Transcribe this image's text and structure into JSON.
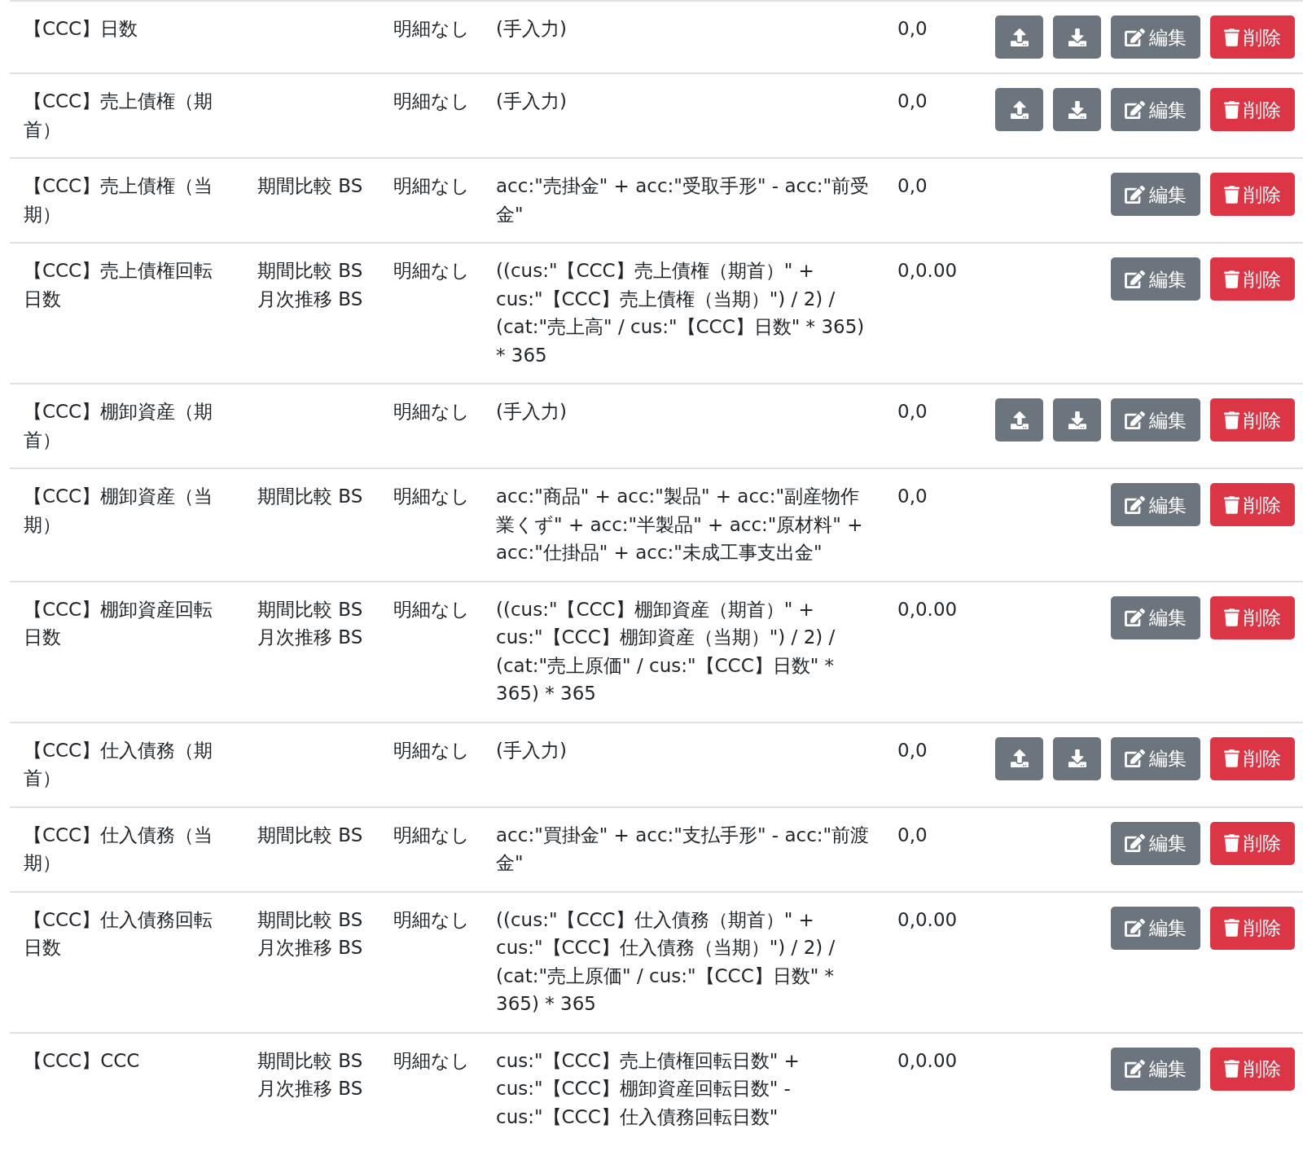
{
  "rows": [
    {
      "column_1": "【CCC】日数",
      "column_3": "明細なし",
      "column_4": "(手入力)",
      "column_5": "0,0",
      "buttons": [
        {
          "kind": "upload"
        },
        {
          "kind": "download"
        },
        {
          "kind": "edit",
          "label": "編集"
        },
        {
          "kind": "delete",
          "label": "削除"
        }
      ]
    },
    {
      "column_1": "【CCC】売上債権（期首）",
      "column_3": "明細なし",
      "column_4": "(手入力)",
      "column_5": "0,0",
      "buttons": [
        {
          "kind": "upload"
        },
        {
          "kind": "download"
        },
        {
          "kind": "edit",
          "label": "編集"
        },
        {
          "kind": "delete",
          "label": "削除"
        }
      ]
    },
    {
      "column_1": "【CCC】売上債権（当期）",
      "column_2": [
        "期間比較 BS"
      ],
      "column_3": "明細なし",
      "column_4": "acc:\"売掛金\" + acc:\"受取手形\" - acc:\"前受金\"",
      "column_5": "0,0",
      "buttons": [
        {
          "kind": "edit",
          "label": "編集"
        },
        {
          "kind": "delete",
          "label": "削除"
        }
      ]
    },
    {
      "column_1": "【CCC】売上債権回転日数",
      "column_2": [
        "期間比較 BS",
        "月次推移 BS"
      ],
      "column_3": "明細なし",
      "column_4": "((cus:\"【CCC】売上債権（期首）\" + cus:\"【CCC】売上債権（当期）\") / 2) / (cat:\"売上高\" / cus:\"【CCC】日数\" * 365) * 365",
      "column_5": "0,0.00",
      "buttons": [
        {
          "kind": "edit",
          "label": "編集"
        },
        {
          "kind": "delete",
          "label": "削除"
        }
      ]
    },
    {
      "column_1": "【CCC】棚卸資産（期首）",
      "column_3": "明細なし",
      "column_4": "(手入力)",
      "column_5": "0,0",
      "buttons": [
        {
          "kind": "upload"
        },
        {
          "kind": "download"
        },
        {
          "kind": "edit",
          "label": "編集"
        },
        {
          "kind": "delete",
          "label": "削除"
        }
      ]
    },
    {
      "column_1": "【CCC】棚卸資産（当期）",
      "column_2": [
        "期間比較 BS"
      ],
      "column_3": "明細なし",
      "column_4": "acc:\"商品\" + acc:\"製品\" + acc:\"副産物作業くず\" + acc:\"半製品\" + acc:\"原材料\" + acc:\"仕掛品\" + acc:\"未成工事支出金\"",
      "column_5": "0,0",
      "buttons": [
        {
          "kind": "edit",
          "label": "編集"
        },
        {
          "kind": "delete",
          "label": "削除"
        }
      ]
    },
    {
      "column_1": "【CCC】棚卸資産回転日数",
      "column_2": [
        "期間比較 BS",
        "月次推移 BS"
      ],
      "column_3": "明細なし",
      "column_4": "((cus:\"【CCC】棚卸資産（期首）\" + cus:\"【CCC】棚卸資産（当期）\") / 2) / (cat:\"売上原価\" / cus:\"【CCC】日数\" * 365) * 365",
      "column_5": "0,0.00",
      "buttons": [
        {
          "kind": "edit",
          "label": "編集"
        },
        {
          "kind": "delete",
          "label": "削除"
        }
      ]
    },
    {
      "column_1": "【CCC】仕入債務（期首）",
      "column_3": "明細なし",
      "column_4": "(手入力)",
      "column_5": "0,0",
      "buttons": [
        {
          "kind": "upload"
        },
        {
          "kind": "download"
        },
        {
          "kind": "edit",
          "label": "編集"
        },
        {
          "kind": "delete",
          "label": "削除"
        }
      ]
    },
    {
      "column_1": "【CCC】仕入債務（当期）",
      "column_2": [
        "期間比較 BS"
      ],
      "column_3": "明細なし",
      "column_4": "acc:\"買掛金\" + acc:\"支払手形\" - acc:\"前渡金\"",
      "column_5": "0,0",
      "buttons": [
        {
          "kind": "edit",
          "label": "編集"
        },
        {
          "kind": "delete",
          "label": "削除"
        }
      ]
    },
    {
      "column_1": "【CCC】仕入債務回転日数",
      "column_2": [
        "期間比較 BS",
        "月次推移 BS"
      ],
      "column_3": "明細なし",
      "column_4": "((cus:\"【CCC】仕入債務（期首）\" + cus:\"【CCC】仕入債務（当期）\") / 2) / (cat:\"売上原価\" / cus:\"【CCC】日数\" * 365) * 365",
      "column_5": "0,0.00",
      "buttons": [
        {
          "kind": "edit",
          "label": "編集"
        },
        {
          "kind": "delete",
          "label": "削除"
        }
      ]
    },
    {
      "column_1": "【CCC】CCC",
      "column_2": [
        "期間比較 BS",
        "月次推移 BS"
      ],
      "column_3": "明細なし",
      "column_4": "cus:\"【CCC】売上債権回転日数\" + cus:\"【CCC】棚卸資産回転日数\" - cus:\"【CCC】仕入債務回転日数\"",
      "column_5": "0,0.00",
      "buttons": [
        {
          "kind": "edit",
          "label": "編集"
        },
        {
          "kind": "delete",
          "label": "削除"
        }
      ]
    }
  ]
}
